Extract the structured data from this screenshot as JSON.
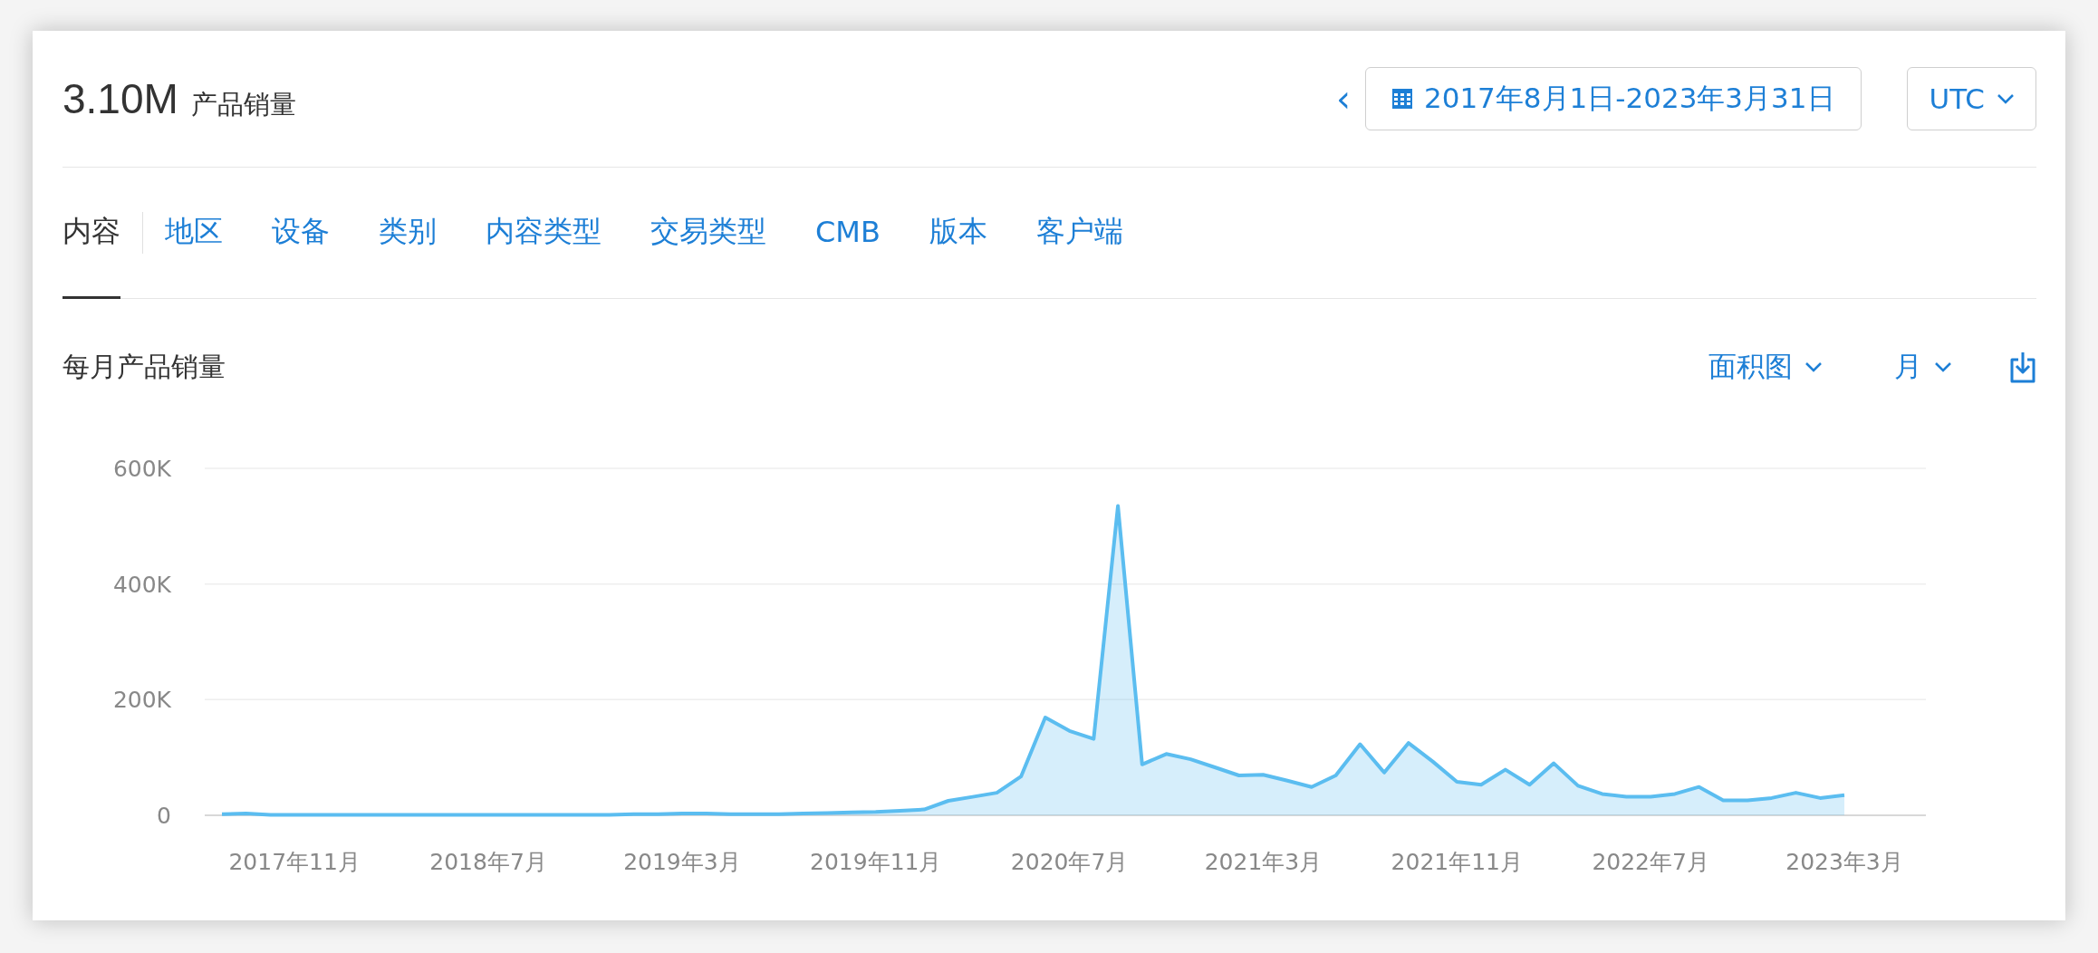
{
  "header": {
    "total": "3.10M",
    "total_label": "产品销量",
    "prev_button": "‹",
    "date_range": "2017年8月1日-2023年3月31日",
    "timezone": "UTC"
  },
  "tabs": [
    {
      "label": "内容",
      "selected": true
    },
    {
      "label": "地区",
      "selected": false
    },
    {
      "label": "设备",
      "selected": false
    },
    {
      "label": "类别",
      "selected": false
    },
    {
      "label": "内容类型",
      "selected": false
    },
    {
      "label": "交易类型",
      "selected": false
    },
    {
      "label": "CMB",
      "selected": false
    },
    {
      "label": "版本",
      "selected": false
    },
    {
      "label": "客户端",
      "selected": false
    }
  ],
  "chart_section": {
    "title": "每月产品销量",
    "chart_type": "面积图",
    "interval": "月",
    "chart_data": {
      "type": "area",
      "ylim": [
        0,
        600000
      ],
      "yticks": [
        {
          "value": 0,
          "label": "0"
        },
        {
          "value": 200000,
          "label": "200K"
        },
        {
          "value": 400000,
          "label": "400K"
        },
        {
          "value": 600000,
          "label": "600K"
        }
      ],
      "categories": [
        null,
        null,
        null,
        "2017年11月",
        null,
        null,
        null,
        null,
        null,
        null,
        null,
        "2018年7月",
        null,
        null,
        null,
        null,
        null,
        null,
        null,
        "2019年3月",
        null,
        null,
        null,
        null,
        null,
        null,
        null,
        "2019年11月",
        null,
        null,
        null,
        null,
        null,
        null,
        null,
        "2020年7月",
        null,
        null,
        null,
        null,
        null,
        null,
        null,
        "2021年3月",
        null,
        null,
        null,
        null,
        null,
        null,
        null,
        "2021年11月",
        null,
        null,
        null,
        null,
        null,
        null,
        null,
        "2022年7月",
        null,
        null,
        null,
        null,
        null,
        null,
        null,
        "2023年3月"
      ],
      "series": [
        {
          "color": "#5bbdf0",
          "values": [
            2000,
            3000,
            1000,
            1000,
            1000,
            1000,
            1000,
            1000,
            1000,
            1000,
            1000,
            1000,
            1000,
            1000,
            1000,
            1000,
            1000,
            2000,
            2000,
            3000,
            3000,
            2000,
            2000,
            2000,
            3000,
            4000,
            5000,
            6000,
            8000,
            10000,
            25000,
            32000,
            39000,
            67000,
            169000,
            146000,
            132000,
            535000,
            88000,
            106000,
            97000,
            83000,
            69000,
            70000,
            60000,
            49000,
            69000,
            123000,
            74000,
            125000,
            93000,
            58000,
            53000,
            79000,
            53000,
            90000,
            51000,
            37000,
            32000,
            32000,
            37000,
            49000,
            26000,
            26000,
            30000,
            39000,
            30000,
            35000
          ]
        }
      ]
    }
  }
}
